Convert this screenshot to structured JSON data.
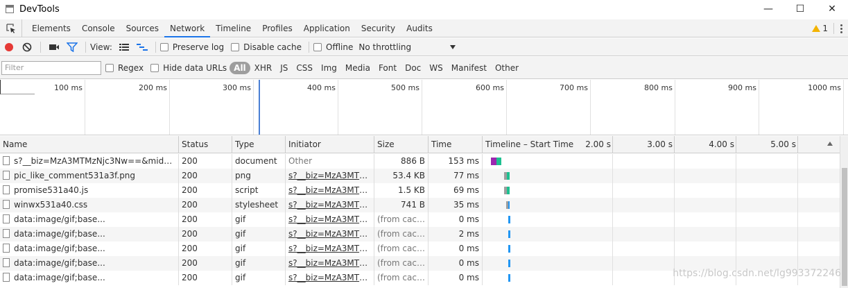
{
  "window": {
    "title": "DevTools",
    "minimize": "—",
    "maximize": "☐",
    "close": "✕"
  },
  "tabs": [
    "Elements",
    "Console",
    "Sources",
    "Network",
    "Timeline",
    "Profiles",
    "Application",
    "Security",
    "Audits"
  ],
  "active_tab": "Network",
  "warnings_count": "1",
  "toolbar": {
    "view_label": "View:",
    "preserve_log": "Preserve log",
    "disable_cache": "Disable cache",
    "offline": "Offline",
    "throttling": "No throttling"
  },
  "filter": {
    "placeholder": "Filter",
    "regex": "Regex",
    "hide_data_urls": "Hide data URLs",
    "types": [
      "All",
      "XHR",
      "JS",
      "CSS",
      "Img",
      "Media",
      "Font",
      "Doc",
      "WS",
      "Manifest",
      "Other"
    ],
    "active_type": "All"
  },
  "overview_labels": [
    "100 ms",
    "200 ms",
    "300 ms",
    "400 ms",
    "500 ms",
    "600 ms",
    "700 ms",
    "800 ms",
    "900 ms",
    "1000 ms"
  ],
  "columns": {
    "name": "Name",
    "status": "Status",
    "type": "Type",
    "initiator": "Initiator",
    "size": "Size",
    "time": "Time",
    "timeline": "Timeline – Start Time"
  },
  "timeline_labels": [
    "2.00 s",
    "3.00 s",
    "4.00 s",
    "5.00 s"
  ],
  "rows": [
    {
      "name": "s?__biz=MzA3MTMzNjc3Nw==&mid=22...",
      "status": "200",
      "type": "document",
      "initiator": "Other",
      "size": "886 B",
      "time": "153 ms"
    },
    {
      "name": "pic_like_comment531a3f.png",
      "status": "200",
      "type": "png",
      "initiator": "s?__biz=MzA3MTMz...",
      "size": "53.4 KB",
      "time": "77 ms"
    },
    {
      "name": "promise531a40.js",
      "status": "200",
      "type": "script",
      "initiator": "s?__biz=MzA3MTMz...",
      "size": "1.5 KB",
      "time": "69 ms"
    },
    {
      "name": "winwx531a40.css",
      "status": "200",
      "type": "stylesheet",
      "initiator": "s?__biz=MzA3MTMz...",
      "size": "741 B",
      "time": "35 ms"
    },
    {
      "name": "data:image/gif;base...",
      "status": "200",
      "type": "gif",
      "initiator": "s?__biz=MzA3MTMz...",
      "size": "(from cache)",
      "time": "0 ms"
    },
    {
      "name": "data:image/gif;base...",
      "status": "200",
      "type": "gif",
      "initiator": "s?__biz=MzA3MTMz...",
      "size": "(from cache)",
      "time": "2 ms"
    },
    {
      "name": "data:image/gif;base...",
      "status": "200",
      "type": "gif",
      "initiator": "s?__biz=MzA3MTMz...",
      "size": "(from cache)",
      "time": "0 ms"
    },
    {
      "name": "data:image/gif;base...",
      "status": "200",
      "type": "gif",
      "initiator": "s?__biz=MzA3MTMz...",
      "size": "(from cache)",
      "time": "0 ms"
    },
    {
      "name": "data:image/gif;base...",
      "status": "200",
      "type": "gif",
      "initiator": "s?__biz=MzA3MTMz...",
      "size": "(from cache)",
      "time": "0 ms"
    }
  ],
  "watermark": "https://blog.csdn.net/lg993372246",
  "colors": {
    "record": "#e53935",
    "accent": "#1a73e8",
    "doc_bar": "#9c27b0",
    "recv_bar": "#1ec090",
    "gif_bar": "#2196f3",
    "wait_bar": "#9e9e9e",
    "warn": "#f3b300"
  }
}
